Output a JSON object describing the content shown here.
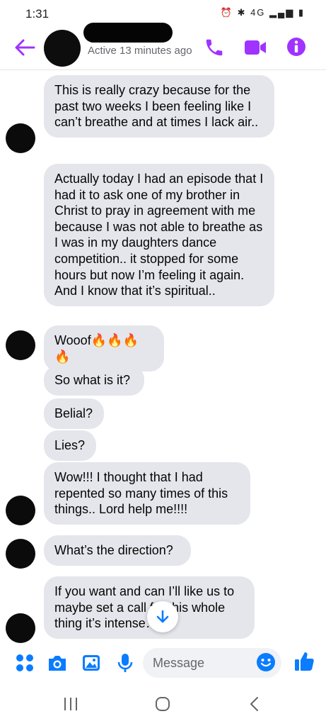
{
  "status_bar": {
    "time": "1:31",
    "icons": "⏰ ✱ 4G ▂▄▆ ▮"
  },
  "header": {
    "active_status": "Active 13 minutes ago",
    "accent_color": "#a033ff"
  },
  "messages": [
    {
      "text": "This is really crazy because for the past two weeks I been feeling like I can’t breathe and at times I lack air.."
    },
    {
      "text": "Actually today I had an episode that I had it to ask one of my brother in Christ to pray in agreement with me because I was not able to breathe as I was in my daughters dance competition.. it stopped for some hours but now I’m feeling it again. And I know that it’s spiritual.."
    },
    {
      "text": "Wooof🔥🔥🔥🔥"
    },
    {
      "text": "So what is it?"
    },
    {
      "text": "Belial?"
    },
    {
      "text": "Lies?"
    },
    {
      "text": "Wow!!! I thought that I had repented so many times of this things.. Lord help me!!!!"
    },
    {
      "text": "What’s the direction?"
    },
    {
      "text": "If you want and can I’ll like us to maybe set a call for this whole thing it’s intense…"
    }
  ],
  "composer": {
    "placeholder": "Message"
  },
  "icons": {
    "back": "arrow-left-icon",
    "call": "phone-icon",
    "video": "video-camera-icon",
    "info": "info-icon",
    "menu": "four-dots-icon",
    "camera": "camera-icon",
    "gallery": "image-icon",
    "mic": "microphone-icon",
    "emoji": "smiley-icon",
    "like": "thumbs-up-icon",
    "scroll": "arrow-down-icon"
  }
}
